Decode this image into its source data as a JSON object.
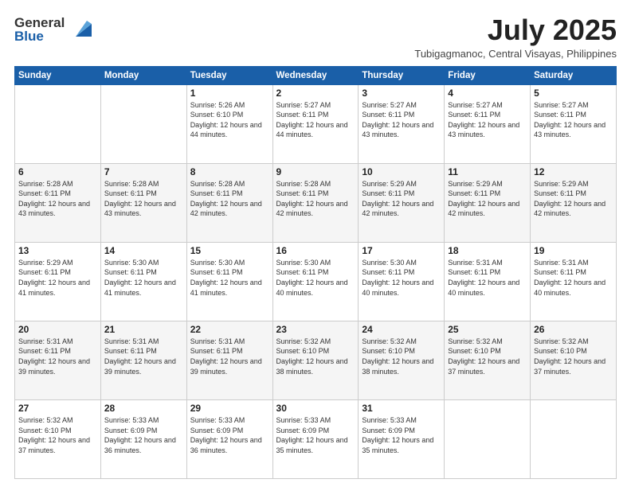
{
  "header": {
    "logo_general": "General",
    "logo_blue": "Blue",
    "title": "July 2025",
    "subtitle": "Tubigagmanoc, Central Visayas, Philippines"
  },
  "days_of_week": [
    "Sunday",
    "Monday",
    "Tuesday",
    "Wednesday",
    "Thursday",
    "Friday",
    "Saturday"
  ],
  "weeks": [
    [
      {
        "day": "",
        "info": ""
      },
      {
        "day": "",
        "info": ""
      },
      {
        "day": "1",
        "info": "Sunrise: 5:26 AM\nSunset: 6:10 PM\nDaylight: 12 hours and 44 minutes."
      },
      {
        "day": "2",
        "info": "Sunrise: 5:27 AM\nSunset: 6:11 PM\nDaylight: 12 hours and 44 minutes."
      },
      {
        "day": "3",
        "info": "Sunrise: 5:27 AM\nSunset: 6:11 PM\nDaylight: 12 hours and 43 minutes."
      },
      {
        "day": "4",
        "info": "Sunrise: 5:27 AM\nSunset: 6:11 PM\nDaylight: 12 hours and 43 minutes."
      },
      {
        "day": "5",
        "info": "Sunrise: 5:27 AM\nSunset: 6:11 PM\nDaylight: 12 hours and 43 minutes."
      }
    ],
    [
      {
        "day": "6",
        "info": "Sunrise: 5:28 AM\nSunset: 6:11 PM\nDaylight: 12 hours and 43 minutes."
      },
      {
        "day": "7",
        "info": "Sunrise: 5:28 AM\nSunset: 6:11 PM\nDaylight: 12 hours and 43 minutes."
      },
      {
        "day": "8",
        "info": "Sunrise: 5:28 AM\nSunset: 6:11 PM\nDaylight: 12 hours and 42 minutes."
      },
      {
        "day": "9",
        "info": "Sunrise: 5:28 AM\nSunset: 6:11 PM\nDaylight: 12 hours and 42 minutes."
      },
      {
        "day": "10",
        "info": "Sunrise: 5:29 AM\nSunset: 6:11 PM\nDaylight: 12 hours and 42 minutes."
      },
      {
        "day": "11",
        "info": "Sunrise: 5:29 AM\nSunset: 6:11 PM\nDaylight: 12 hours and 42 minutes."
      },
      {
        "day": "12",
        "info": "Sunrise: 5:29 AM\nSunset: 6:11 PM\nDaylight: 12 hours and 42 minutes."
      }
    ],
    [
      {
        "day": "13",
        "info": "Sunrise: 5:29 AM\nSunset: 6:11 PM\nDaylight: 12 hours and 41 minutes."
      },
      {
        "day": "14",
        "info": "Sunrise: 5:30 AM\nSunset: 6:11 PM\nDaylight: 12 hours and 41 minutes."
      },
      {
        "day": "15",
        "info": "Sunrise: 5:30 AM\nSunset: 6:11 PM\nDaylight: 12 hours and 41 minutes."
      },
      {
        "day": "16",
        "info": "Sunrise: 5:30 AM\nSunset: 6:11 PM\nDaylight: 12 hours and 40 minutes."
      },
      {
        "day": "17",
        "info": "Sunrise: 5:30 AM\nSunset: 6:11 PM\nDaylight: 12 hours and 40 minutes."
      },
      {
        "day": "18",
        "info": "Sunrise: 5:31 AM\nSunset: 6:11 PM\nDaylight: 12 hours and 40 minutes."
      },
      {
        "day": "19",
        "info": "Sunrise: 5:31 AM\nSunset: 6:11 PM\nDaylight: 12 hours and 40 minutes."
      }
    ],
    [
      {
        "day": "20",
        "info": "Sunrise: 5:31 AM\nSunset: 6:11 PM\nDaylight: 12 hours and 39 minutes."
      },
      {
        "day": "21",
        "info": "Sunrise: 5:31 AM\nSunset: 6:11 PM\nDaylight: 12 hours and 39 minutes."
      },
      {
        "day": "22",
        "info": "Sunrise: 5:31 AM\nSunset: 6:11 PM\nDaylight: 12 hours and 39 minutes."
      },
      {
        "day": "23",
        "info": "Sunrise: 5:32 AM\nSunset: 6:10 PM\nDaylight: 12 hours and 38 minutes."
      },
      {
        "day": "24",
        "info": "Sunrise: 5:32 AM\nSunset: 6:10 PM\nDaylight: 12 hours and 38 minutes."
      },
      {
        "day": "25",
        "info": "Sunrise: 5:32 AM\nSunset: 6:10 PM\nDaylight: 12 hours and 37 minutes."
      },
      {
        "day": "26",
        "info": "Sunrise: 5:32 AM\nSunset: 6:10 PM\nDaylight: 12 hours and 37 minutes."
      }
    ],
    [
      {
        "day": "27",
        "info": "Sunrise: 5:32 AM\nSunset: 6:10 PM\nDaylight: 12 hours and 37 minutes."
      },
      {
        "day": "28",
        "info": "Sunrise: 5:33 AM\nSunset: 6:09 PM\nDaylight: 12 hours and 36 minutes."
      },
      {
        "day": "29",
        "info": "Sunrise: 5:33 AM\nSunset: 6:09 PM\nDaylight: 12 hours and 36 minutes."
      },
      {
        "day": "30",
        "info": "Sunrise: 5:33 AM\nSunset: 6:09 PM\nDaylight: 12 hours and 35 minutes."
      },
      {
        "day": "31",
        "info": "Sunrise: 5:33 AM\nSunset: 6:09 PM\nDaylight: 12 hours and 35 minutes."
      },
      {
        "day": "",
        "info": ""
      },
      {
        "day": "",
        "info": ""
      }
    ]
  ]
}
